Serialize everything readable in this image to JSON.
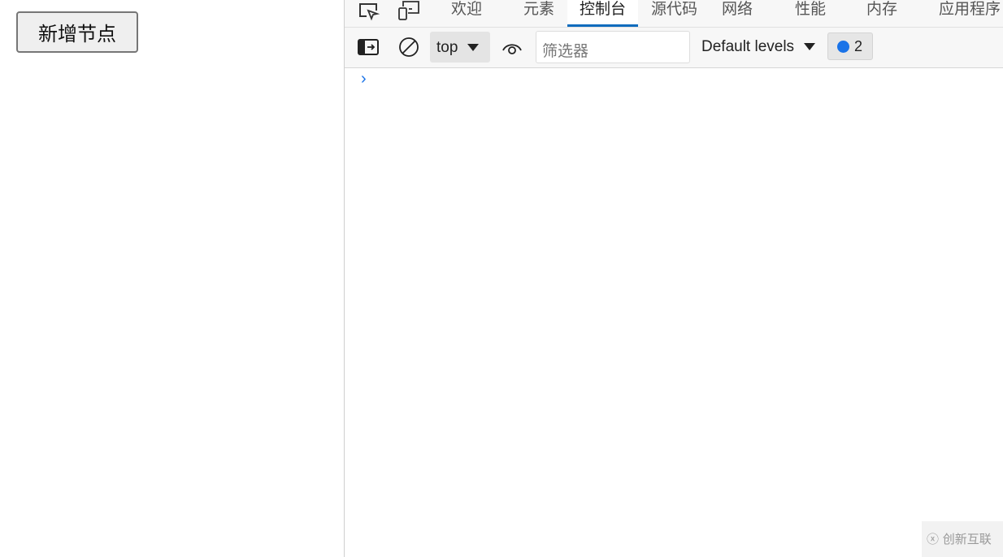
{
  "page": {
    "button_label": "新增节点"
  },
  "devtools": {
    "tabs": [
      {
        "label": "欢迎"
      },
      {
        "label": "元素"
      },
      {
        "label": "控制台",
        "active": true
      },
      {
        "label": "源代码"
      },
      {
        "label": "网络"
      },
      {
        "label": "性能"
      },
      {
        "label": "内存"
      },
      {
        "label": "应用程序"
      }
    ],
    "toolbar": {
      "context": "top",
      "filter_placeholder": "筛选器",
      "levels": "Default levels",
      "message_count": "2"
    },
    "prompt": "›"
  },
  "watermark": "创新互联",
  "colors": {
    "accent": "#0f6cbd",
    "info": "#1a73e8"
  }
}
